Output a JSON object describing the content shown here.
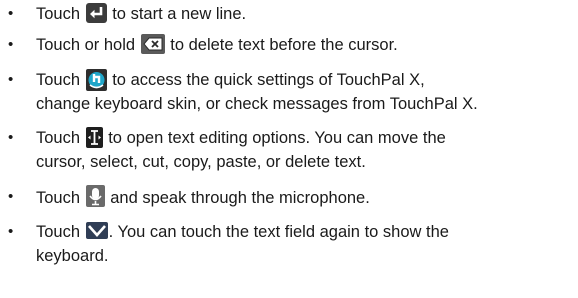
{
  "items": [
    {
      "before": "Touch",
      "icon": "enter-icon",
      "after": "to start a new line.",
      "line2": ""
    },
    {
      "before": "Touch or hold",
      "icon": "backspace-icon",
      "after": "to delete text before the cursor.",
      "line2": ""
    },
    {
      "before": "Touch",
      "icon": "touchpal-settings-icon",
      "after": "to access the quick settings of TouchPal X,",
      "line2": "change keyboard skin, or check messages from TouchPal X."
    },
    {
      "before": "Touch",
      "icon": "text-cursor-icon",
      "after": "to open text editing options. You can move the",
      "line2": "cursor, select, cut, copy, paste, or delete text."
    },
    {
      "before": "Touch",
      "icon": "microphone-icon",
      "after": "and speak through the microphone.",
      "line2": ""
    },
    {
      "before": "Touch",
      "icon": "hide-keyboard-icon",
      "after": ". You can touch the text field again to show the",
      "line2": "keyboard."
    }
  ],
  "bullet": "•"
}
